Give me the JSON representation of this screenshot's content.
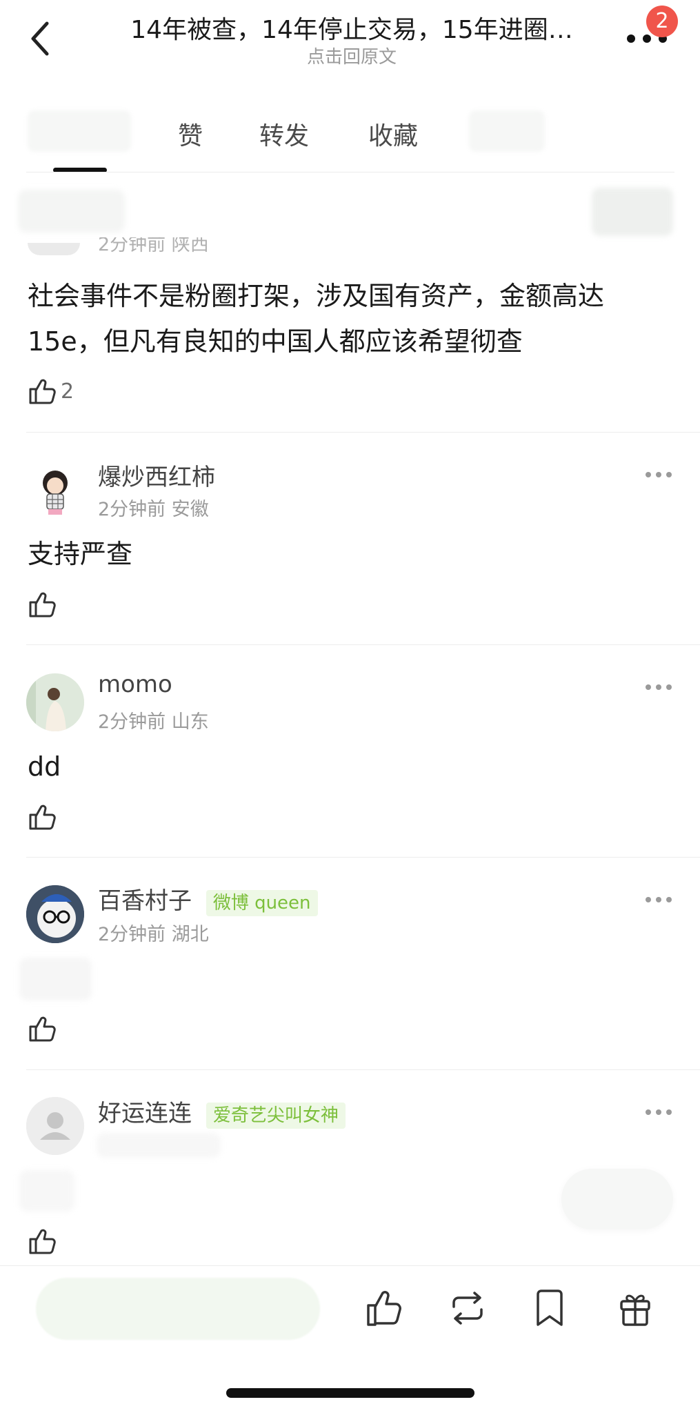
{
  "header": {
    "title": "14年被查，14年停止交易，15年进圈…",
    "subtitle": "点击回原文",
    "notification_count": "2"
  },
  "tabs": [
    {
      "label": "赞"
    },
    {
      "label": "转发"
    },
    {
      "label": "收藏"
    }
  ],
  "first_comment": {
    "meta_partial": "2分钟前 陕西",
    "text_line1": "社会事件不是粉圈打架，涉及国有资产，金额高达",
    "text_line2": "15e，但凡有良知的中国人都应该希望彻查",
    "likes": "2"
  },
  "comments": [
    {
      "username": "爆炒西红柿",
      "tag": "",
      "time": "2分钟前",
      "location": "安徽",
      "text": "支持严查"
    },
    {
      "username": "momo",
      "tag": "",
      "time": "2分钟前",
      "location": "山东",
      "text": "dd"
    },
    {
      "username": "百香村子",
      "tag": "微博 queen",
      "time": "2分钟前",
      "location": "湖北",
      "text": ""
    },
    {
      "username": "好运连连",
      "tag": "爱奇艺尖叫女神",
      "time": "",
      "location": "",
      "text": ""
    }
  ],
  "colors": {
    "badge": "#f0554b",
    "tag_text": "#7cbf3b",
    "tag_bg": "#eef8e6"
  },
  "icons": [
    "back-arrow-icon",
    "more-dots-icon",
    "thumbs-up-icon",
    "repost-icon",
    "bookmark-icon",
    "gift-icon",
    "avatar-placeholder-icon"
  ]
}
